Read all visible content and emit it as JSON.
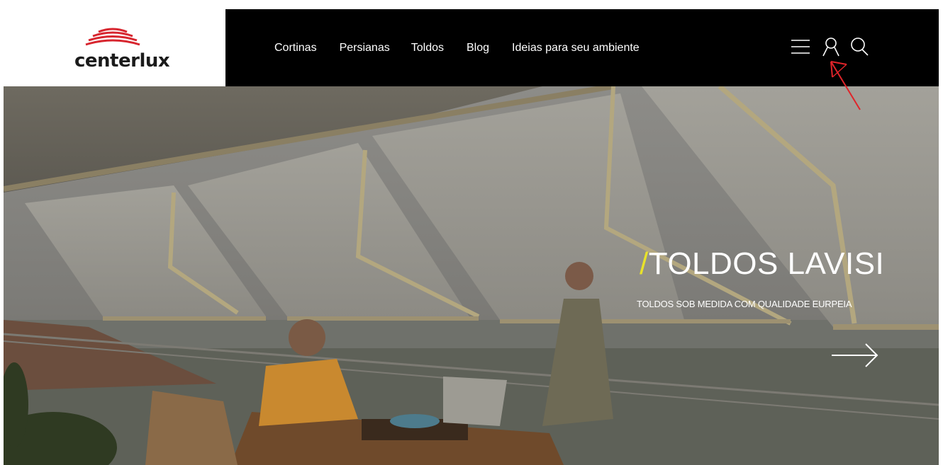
{
  "brand": {
    "name": "centerlux"
  },
  "nav": {
    "items": [
      {
        "label": "Cortinas"
      },
      {
        "label": "Persianas"
      },
      {
        "label": "Toldos"
      },
      {
        "label": "Blog"
      },
      {
        "label": "Ideias para seu ambiente"
      }
    ]
  },
  "header_icons": [
    "menu-icon",
    "user-icon",
    "search-icon"
  ],
  "hero": {
    "slash": "/",
    "title": "TOLDOS LAVISI",
    "subtitle": "TOLDOS SOB MEDIDA COM QUALIDADE EURPEIA",
    "next_icon": "arrow-right-icon"
  },
  "colors": {
    "header_bg": "#000000",
    "accent": "#e8e22a",
    "logo_red": "#d7262f",
    "annotation": "#e0242a"
  }
}
